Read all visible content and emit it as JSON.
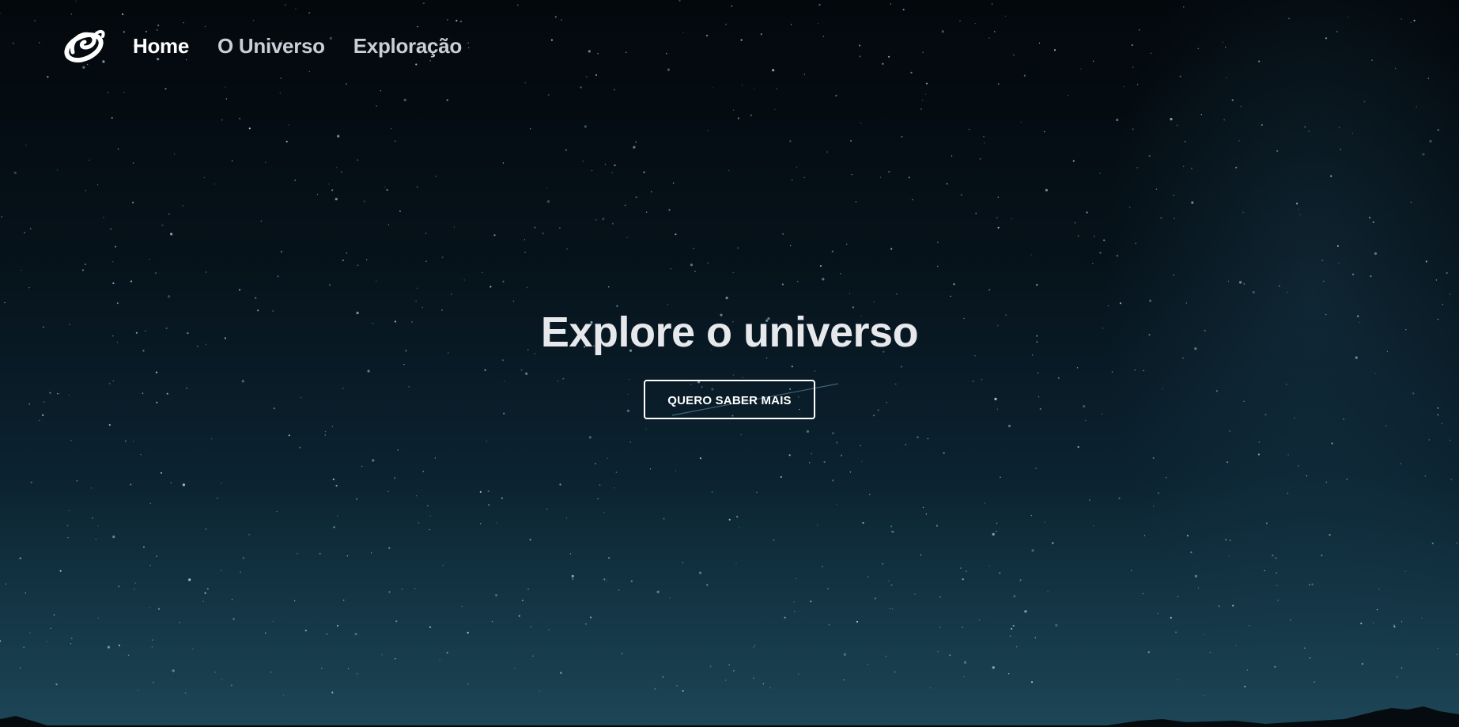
{
  "nav": {
    "logo_icon": "spiral-galaxy-icon",
    "items": [
      {
        "label": "Home",
        "active": true
      },
      {
        "label": "O Universo",
        "active": false
      },
      {
        "label": "Exploração",
        "active": false
      }
    ]
  },
  "hero": {
    "title": "Explore o universo",
    "cta_label": "QUERO SABER MAIS",
    "background": "starry-night-sky"
  },
  "colors": {
    "text_primary": "#ffffff",
    "text_nav_inactive": "#c9cfd6",
    "sky_top": "#03080c",
    "sky_bottom": "#1d4656"
  }
}
